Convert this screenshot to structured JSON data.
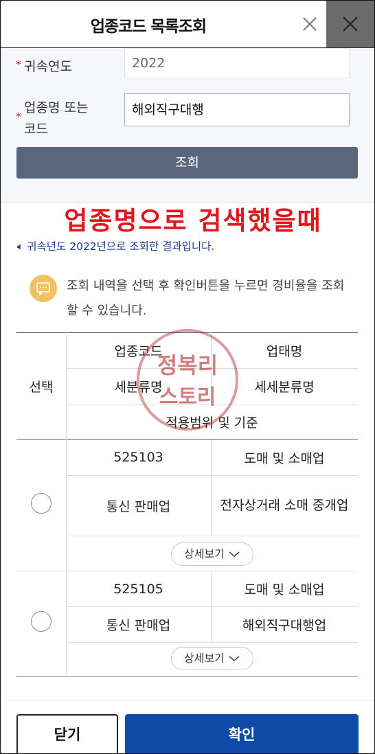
{
  "header": {
    "title": "업종코드 목록조회",
    "close_icon": "close-icon"
  },
  "form": {
    "year_label": "귀속연도",
    "year_value": "2022",
    "name_label_line1": "업종명 또는",
    "name_label_line2": "코드",
    "name_value": "해외직구대행",
    "search_button": "조회"
  },
  "caption": "업종명으로 검색했을때",
  "result_text": "귀속년도 2022년으로 조회한 결과입니다.",
  "notice": "조회 내역을 선택 후 확인버튼을 누르면 경비율을 조회 할 수 있습니다.",
  "table": {
    "head": {
      "select": "선택",
      "code": "업종코드",
      "type": "업태명",
      "subclass": "세분류명",
      "subsubclass": "세세분류명",
      "scope": "적용범위 및 기준"
    },
    "rows": [
      {
        "code": "525103",
        "type": "도매 및 소매업",
        "subclass": "통신 판매업",
        "subsubclass": "전자상거래 소매 중개업",
        "detail": "상세보기"
      },
      {
        "code": "525105",
        "type": "도매 및 소매업",
        "subclass": "통신 판매업",
        "subsubclass": "해외직구대행업",
        "detail": "상세보기"
      }
    ]
  },
  "watermark": {
    "line1": "정복리",
    "line2": "스토리"
  },
  "footer": {
    "close_button": "닫기",
    "confirm_button": "확인"
  },
  "colors": {
    "primary": "#0e4aa8",
    "search_button": "#5a667b",
    "caption": "#e3141b",
    "notice_icon": "#f0c261"
  }
}
